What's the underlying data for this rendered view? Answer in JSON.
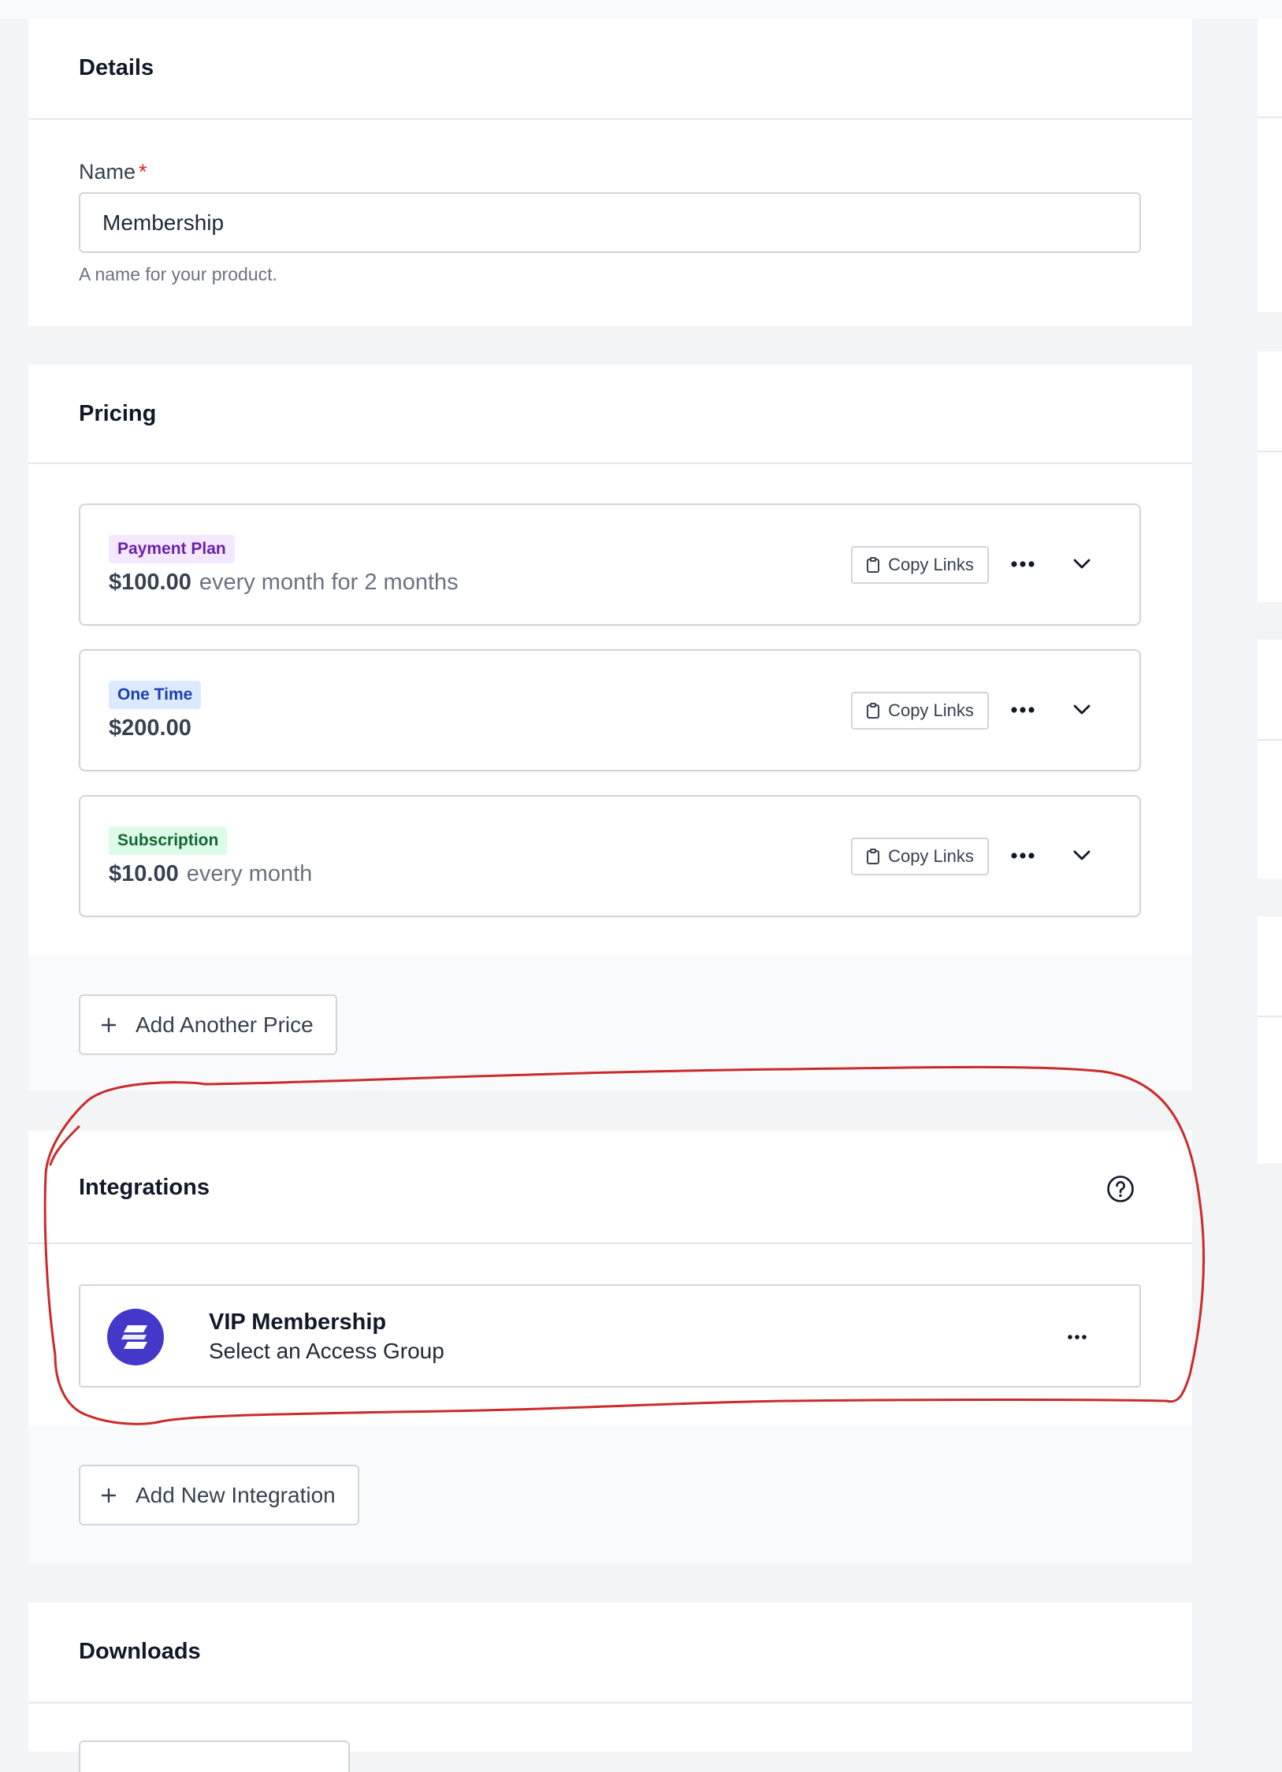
{
  "details": {
    "title": "Details",
    "name_label": "Name",
    "required_mark": "*",
    "name_value": "Membership",
    "name_help": "A name for your product."
  },
  "pricing": {
    "title": "Pricing",
    "copy_label": "Copy Links",
    "prices": [
      {
        "badge": "Payment Plan",
        "badge_color": "#6b21a8",
        "amount": "$100.00",
        "interval": "every month for 2 months"
      },
      {
        "badge": "One Time",
        "badge_color": "#1e40af",
        "amount": "$200.00",
        "interval": ""
      },
      {
        "badge": "Subscription",
        "badge_color": "#166534",
        "amount": "$10.00",
        "interval": "every month"
      }
    ],
    "add_label": "Add Another Price"
  },
  "integrations": {
    "title": "Integrations",
    "help_icon": "question-circle-icon",
    "items": [
      {
        "name": "VIP Membership",
        "subtitle": "Select an Access Group",
        "logo_icon": "integration-logo-icon",
        "logo_color": "#4338ca"
      }
    ],
    "add_label": "Add New Integration"
  },
  "downloads": {
    "title": "Downloads"
  },
  "annotation": {
    "color": "#cc2a2a",
    "shape": "freehand-circle"
  }
}
